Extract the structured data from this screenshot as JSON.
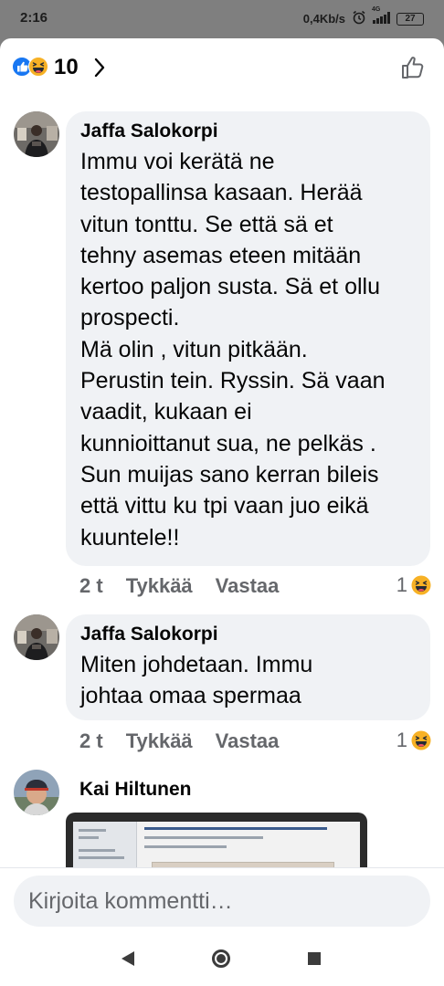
{
  "status_bar": {
    "time": "2:16",
    "network_speed": "0,4Kb/s",
    "network_type": "4G",
    "battery": "27"
  },
  "reactions": {
    "icons": [
      "like-icon",
      "haha-icon"
    ],
    "count": "10"
  },
  "comments": [
    {
      "author": "Jaffa Salokorpi",
      "lines": [
        "Immu voi kerätä ne",
        "testopallinsa kasaan. Herää",
        "vitun tonttu. Se että sä et",
        "tehny asemas eteen mitään",
        "kertoo paljon susta. Sä et ollu",
        "prospecti.",
        "Mä olin , vitun pitkään.",
        "Perustin tein. Ryssin. Sä vaan",
        "vaadit, kukaan ei",
        "kunnioittanut sua, ne pelkäs .",
        "Sun muijas sano kerran bileis",
        "että vittu ku tpi vaan juo eikä",
        "kuuntele!!"
      ],
      "time": "2 t",
      "like_label": "Tykkää",
      "reply_label": "Vastaa",
      "reaction_count": "1"
    },
    {
      "author": "Jaffa Salokorpi",
      "lines": [
        "Miten johdetaan. Immu",
        "johtaa omaa spermaa"
      ],
      "time": "2 t",
      "like_label": "Tykkää",
      "reply_label": "Vastaa",
      "reaction_count": "1"
    },
    {
      "author": "Kai Hiltunen"
    }
  ],
  "compose": {
    "placeholder": "Kirjoita kommentti…"
  },
  "colors": {
    "accent": "#1877f2",
    "bubble": "#f0f2f5",
    "meta_text": "#65676b",
    "haha": "#f7b125"
  }
}
